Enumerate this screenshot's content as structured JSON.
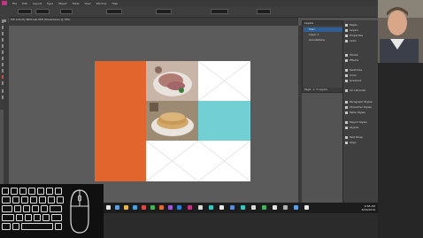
{
  "app": {
    "menu": [
      "File",
      "Edit",
      "Layout",
      "Type",
      "Object",
      "Table",
      "View",
      "Window",
      "Help"
    ],
    "doc_tab_title": "ISE Activity MIM-Lab PDF (Elsewhere) @ 56%",
    "control_values": {
      "zoom": "100%",
      "x_field": "0 in",
      "w_field": "0 in"
    }
  },
  "layers_panel": {
    "title": "Layers",
    "rows": [
      {
        "label": "Main"
      },
      {
        "label": "Layer 1"
      },
      {
        "label": "Annotations"
      }
    ],
    "footer": "Page: 1, 3 Layers"
  },
  "right_panel": {
    "items": [
      "Pages",
      "Layers",
      "Properties",
      "Links",
      "Stroke",
      "Effects",
      "Swatches",
      "Color",
      "Gradient",
      "CC Libraries",
      "Paragraph Styles",
      "Character Styles",
      "Table Styles",
      "Object Styles",
      "Glyphs",
      "Text Wrap",
      "Align"
    ]
  },
  "taskbar": {
    "time": "9:58 AM",
    "date": "8/16/2019"
  },
  "accent_colors": {
    "orange_block": "#e2652e",
    "teal_block": "#72d0d4",
    "selection_blue": "#2f5f94"
  }
}
